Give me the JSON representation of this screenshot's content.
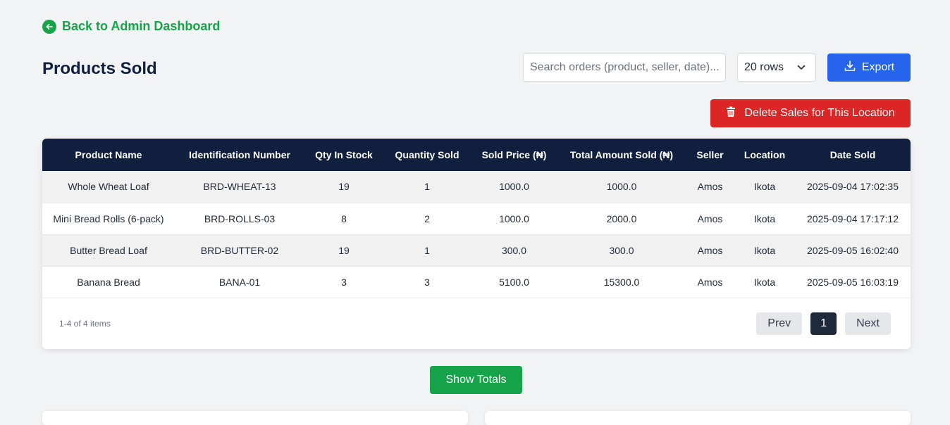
{
  "back_link": {
    "label": "Back to Admin Dashboard"
  },
  "page_title": "Products Sold",
  "search": {
    "placeholder": "Search orders (product, seller, date)..."
  },
  "rows_select": {
    "value": "20 rows"
  },
  "export_button": {
    "label": "Export"
  },
  "delete_button": {
    "label": "Delete Sales for This Location"
  },
  "table": {
    "columns": [
      "Product Name",
      "Identification Number",
      "Qty In Stock",
      "Quantity Sold",
      "Sold Price (₦)",
      "Total Amount Sold (₦)",
      "Seller",
      "Location",
      "Date Sold"
    ],
    "rows": [
      [
        "Whole Wheat Loaf",
        "BRD-WHEAT-13",
        "19",
        "1",
        "1000.0",
        "1000.0",
        "Amos",
        "Ikota",
        "2025-09-04 17:02:35"
      ],
      [
        "Mini Bread Rolls (6-pack)",
        "BRD-ROLLS-03",
        "8",
        "2",
        "1000.0",
        "2000.0",
        "Amos",
        "Ikota",
        "2025-09-04 17:17:12"
      ],
      [
        "Butter Bread Loaf",
        "BRD-BUTTER-02",
        "19",
        "1",
        "300.0",
        "300.0",
        "Amos",
        "Ikota",
        "2025-09-05 16:02:40"
      ],
      [
        "Banana Bread",
        "BANA-01",
        "3",
        "3",
        "5100.0",
        "15300.0",
        "Amos",
        "Ikota",
        "2025-09-05 16:03:19"
      ]
    ]
  },
  "pagination": {
    "info": "1-4 of 4 items",
    "prev_label": "Prev",
    "current_page": "1",
    "next_label": "Next"
  },
  "totals_button": {
    "label": "Show Totals"
  },
  "colors": {
    "accent_green": "#16a34a",
    "primary_blue": "#2563eb",
    "danger_red": "#dc2626",
    "header_navy": "#0f1f3d"
  },
  "icons": {
    "back": "arrow-left-circle-icon",
    "export": "download-icon",
    "delete": "trash-icon",
    "select": "chevron-down-icon"
  }
}
